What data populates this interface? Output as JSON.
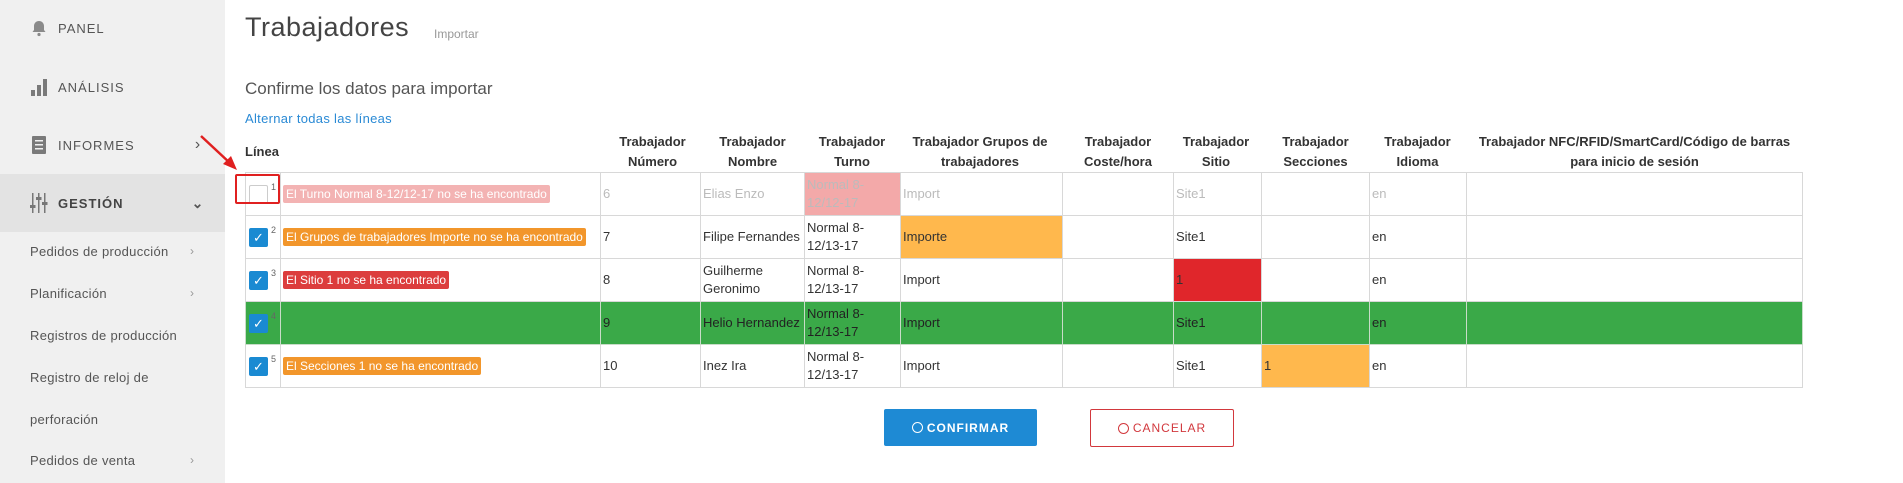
{
  "sidebar": {
    "main": [
      {
        "label": "PANEL",
        "icon": "bell-icon"
      },
      {
        "label": "ANÁLISIS",
        "icon": "bar-chart-icon"
      },
      {
        "label": "INFORMES",
        "icon": "document-icon"
      },
      {
        "label": "GESTIÓN",
        "icon": "sliders-icon"
      }
    ],
    "sub": [
      {
        "label": "Pedidos de producción"
      },
      {
        "label": "Planificación"
      },
      {
        "label": "Registros de producción"
      },
      {
        "label": "Registro de reloj de"
      },
      {
        "label": "perforación"
      },
      {
        "label": "Pedidos de venta"
      }
    ]
  },
  "header": {
    "title": "Trabajadores",
    "subtitle": "Importar"
  },
  "section": {
    "title": "Confirme los datos para importar",
    "toggle_all": "Alternar todas las líneas"
  },
  "table": {
    "headers": {
      "linea": "Línea",
      "numero": "Trabajador Número",
      "nombre": "Trabajador Nombre",
      "turno": "Trabajador Turno",
      "grupos": "Trabajador Grupos de trabajadores",
      "coste": "Trabajador Coste/hora",
      "sitio": "Trabajador Sitio",
      "secciones": "Trabajador Secciones",
      "idioma": "Trabajador Idioma",
      "nfc": "Trabajador NFC/RFID/SmartCard/Código de barras para inicio de sesión"
    },
    "rows": [
      {
        "line": "1",
        "checked": false,
        "error": "El Turno Normal 8-12/12-17 no se ha encontrado",
        "numero": "6",
        "nombre": "Elias Enzo",
        "turno": "Normal 8-12/12-17",
        "grupos": "Import",
        "coste": "",
        "sitio": "Site1",
        "secciones": "",
        "idioma": "en",
        "nfc": ""
      },
      {
        "line": "2",
        "checked": true,
        "error": "El Grupos de trabajadores Importe no se ha encontrado",
        "numero": "7",
        "nombre": "Filipe Fernandes",
        "turno": "Normal 8-12/13-17",
        "grupos": "Importe",
        "coste": "",
        "sitio": "Site1",
        "secciones": "",
        "idioma": "en",
        "nfc": ""
      },
      {
        "line": "3",
        "checked": true,
        "error": "El Sitio 1 no se ha encontrado",
        "numero": "8",
        "nombre": "Guilherme Geronimo",
        "turno": "Normal 8-12/13-17",
        "grupos": "Import",
        "coste": "",
        "sitio": "1",
        "secciones": "",
        "idioma": "en",
        "nfc": ""
      },
      {
        "line": "4",
        "checked": true,
        "error": "",
        "numero": "9",
        "nombre": "Helio Hernandez",
        "turno": "Normal 8-12/13-17",
        "grupos": "Import",
        "coste": "",
        "sitio": "Site1",
        "secciones": "",
        "idioma": "en",
        "nfc": ""
      },
      {
        "line": "5",
        "checked": true,
        "error": "El Secciones 1 no se ha encontrado",
        "numero": "10",
        "nombre": "Inez Ira",
        "turno": "Normal 8-12/13-17",
        "grupos": "Import",
        "coste": "",
        "sitio": "Site1",
        "secciones": "1",
        "idioma": "en",
        "nfc": ""
      }
    ]
  },
  "buttons": {
    "confirm": "CONFIRMAR",
    "cancel": "CANCELAR"
  },
  "checkmark": "✓",
  "colors": {
    "accent": "#1e8ad4",
    "ok_row": "#3aa948",
    "warn": "#ffb84d",
    "error": "#e0262b",
    "cancel": "#d2383d"
  }
}
